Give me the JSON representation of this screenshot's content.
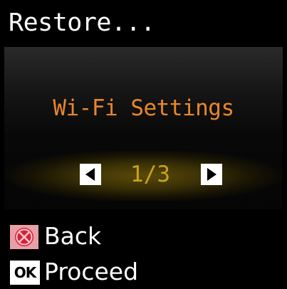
{
  "title": "Restore...",
  "option": {
    "label": "Wi-Fi Settings",
    "page": "1/3"
  },
  "colors": {
    "option_text": "#e8862a",
    "page_text": "#c9a21a",
    "highlight": "#5a4a08",
    "stop_icon": "#e8a0a6"
  },
  "footer": {
    "back": {
      "icon": "stop-icon",
      "label": "Back"
    },
    "proceed": {
      "icon_text": "OK",
      "label": "Proceed"
    }
  }
}
